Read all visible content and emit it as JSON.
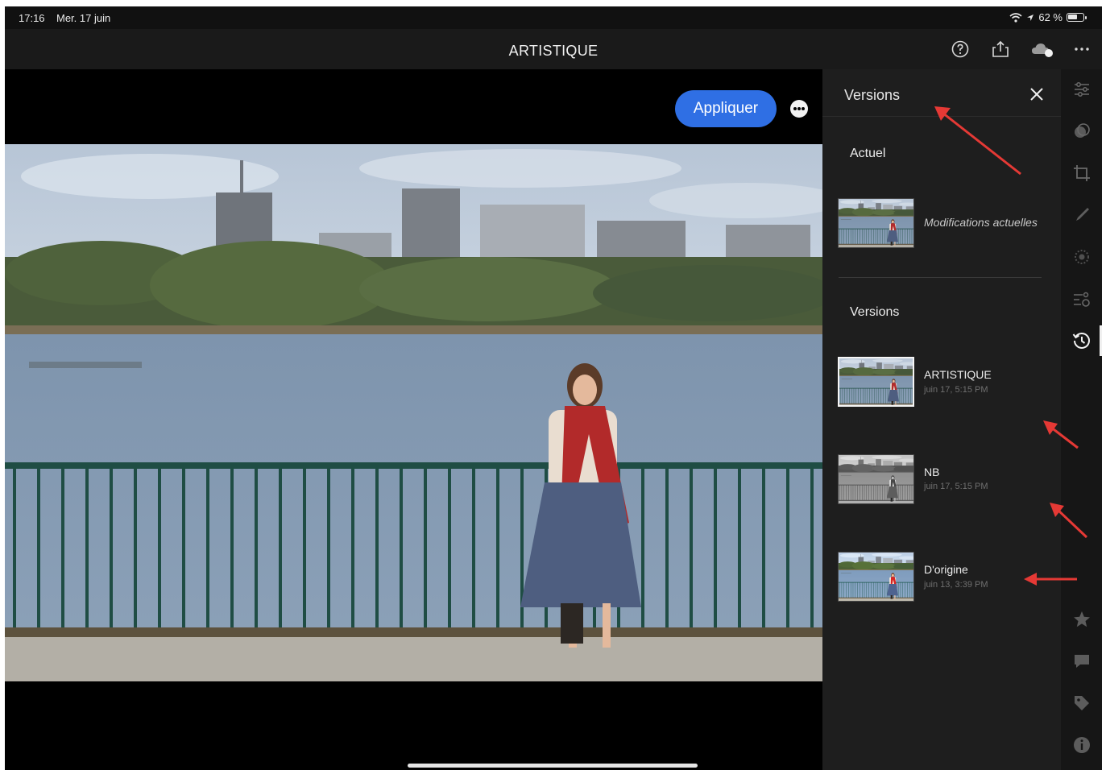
{
  "status": {
    "time": "17:16",
    "date": "Mer. 17 juin",
    "battery": "62 %"
  },
  "topbar": {
    "title": "ARTISTIQUE"
  },
  "canvas": {
    "apply_label": "Appliquer"
  },
  "panel": {
    "title": "Versions",
    "current_section": "Actuel",
    "current_label": "Modifications actuelles",
    "versions_section": "Versions",
    "versions": [
      {
        "name": "ARTISTIQUE",
        "date": "juin 17, 5:15 PM",
        "style": "color"
      },
      {
        "name": "NB",
        "date": "juin 17, 5:15 PM",
        "style": "bw"
      },
      {
        "name": "D'origine",
        "date": "juin 13, 3:39 PM",
        "style": "original"
      }
    ]
  },
  "toolbar": {
    "items": [
      "edit-sliders-icon",
      "presets-icon",
      "crop-icon",
      "healing-brush-icon",
      "selective-icon",
      "masking-icon",
      "versions-history-icon",
      "star-icon",
      "comment-icon",
      "tag-icon",
      "info-icon"
    ],
    "active": "versions-history-icon"
  },
  "colors": {
    "accent": "#2f6fe4",
    "annotation": "#e53935",
    "panel": "#1e1e1e"
  }
}
